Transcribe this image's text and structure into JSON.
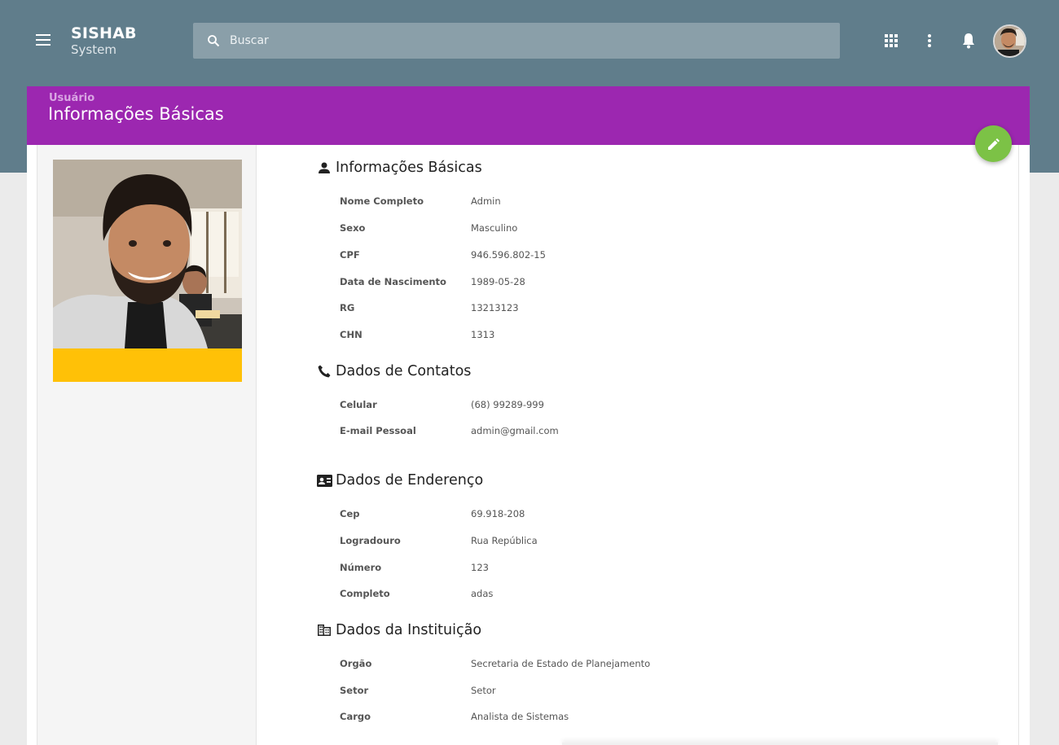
{
  "app": {
    "name": "SISHAB",
    "subtitle": "System"
  },
  "search": {
    "placeholder": "Buscar"
  },
  "toolbar": {
    "icons": [
      "menu-icon",
      "apps-grid-icon",
      "more-vert-icon",
      "notifications-icon",
      "user-avatar"
    ]
  },
  "header": {
    "breadcrumb": "Usuário",
    "title": "Informações Básicas",
    "accent": "#9c27b0",
    "fab_color": "#7cc246"
  },
  "profile": {
    "photo_bar_color": "#ffc107"
  },
  "sections": {
    "basic": {
      "title": "Informações Básicas",
      "icon": "person-icon",
      "fields": [
        {
          "label": "Nome Completo",
          "value": "Admin"
        },
        {
          "label": "Sexo",
          "value": "Masculino"
        },
        {
          "label": "CPF",
          "value": "946.596.802-15"
        },
        {
          "label": "Data de Nascimento",
          "value": "1989-05-28"
        },
        {
          "label": "RG",
          "value": "13213123"
        },
        {
          "label": "CHN",
          "value": "1313"
        }
      ]
    },
    "contacts": {
      "title": "Dados de Contatos",
      "icon": "phone-icon",
      "fields": [
        {
          "label": "Celular",
          "value": "(68) 99289-999"
        },
        {
          "label": "E-mail Pessoal",
          "value": "admin@gmail.com"
        }
      ]
    },
    "address": {
      "title": "Dados de Enderenço",
      "icon": "contact-card-icon",
      "fields": [
        {
          "label": "Cep",
          "value": "69.918-208"
        },
        {
          "label": "Logradouro",
          "value": "Rua República"
        },
        {
          "label": "Número",
          "value": "123"
        },
        {
          "label": "Completo",
          "value": "adas"
        }
      ]
    },
    "institution": {
      "title": "Dados da Instituição",
      "icon": "building-icon",
      "fields": [
        {
          "label": "Orgão",
          "value": "Secretaria de Estado de Planejamento"
        },
        {
          "label": "Setor",
          "value": "Setor"
        },
        {
          "label": "Cargo",
          "value": "Analista de Sistemas"
        }
      ]
    }
  }
}
